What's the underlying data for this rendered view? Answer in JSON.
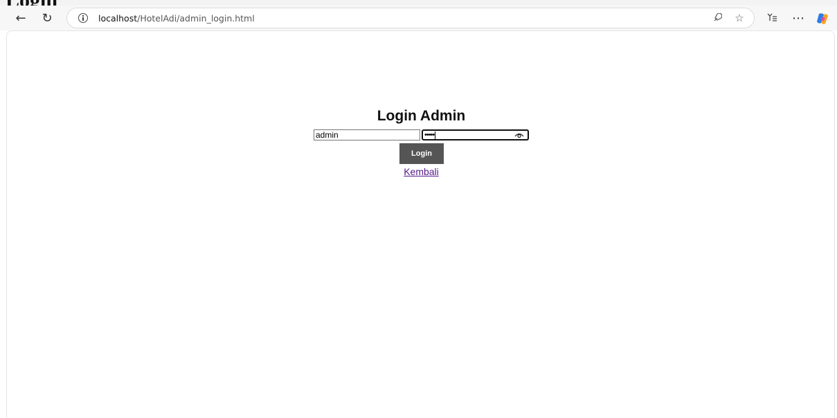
{
  "page_heading_fragment": "Login",
  "browser": {
    "url_host": "localhost",
    "url_path": "/HotelAdi/admin_login.html",
    "icons": {
      "back": "back-arrow-icon",
      "refresh": "refresh-icon",
      "info": "info-icon",
      "read_aloud": "read-aloud-icon",
      "favorite": "star-icon",
      "collections": "collections-icon",
      "more": "more-icon",
      "copilot": "copilot-icon"
    }
  },
  "form": {
    "title": "Login Admin",
    "username_value": "admin",
    "password_masked": "•••••",
    "login_label": "Login",
    "back_label": "Kembali"
  },
  "colors": {
    "button_bg": "#555555",
    "link": "#551a8b"
  }
}
